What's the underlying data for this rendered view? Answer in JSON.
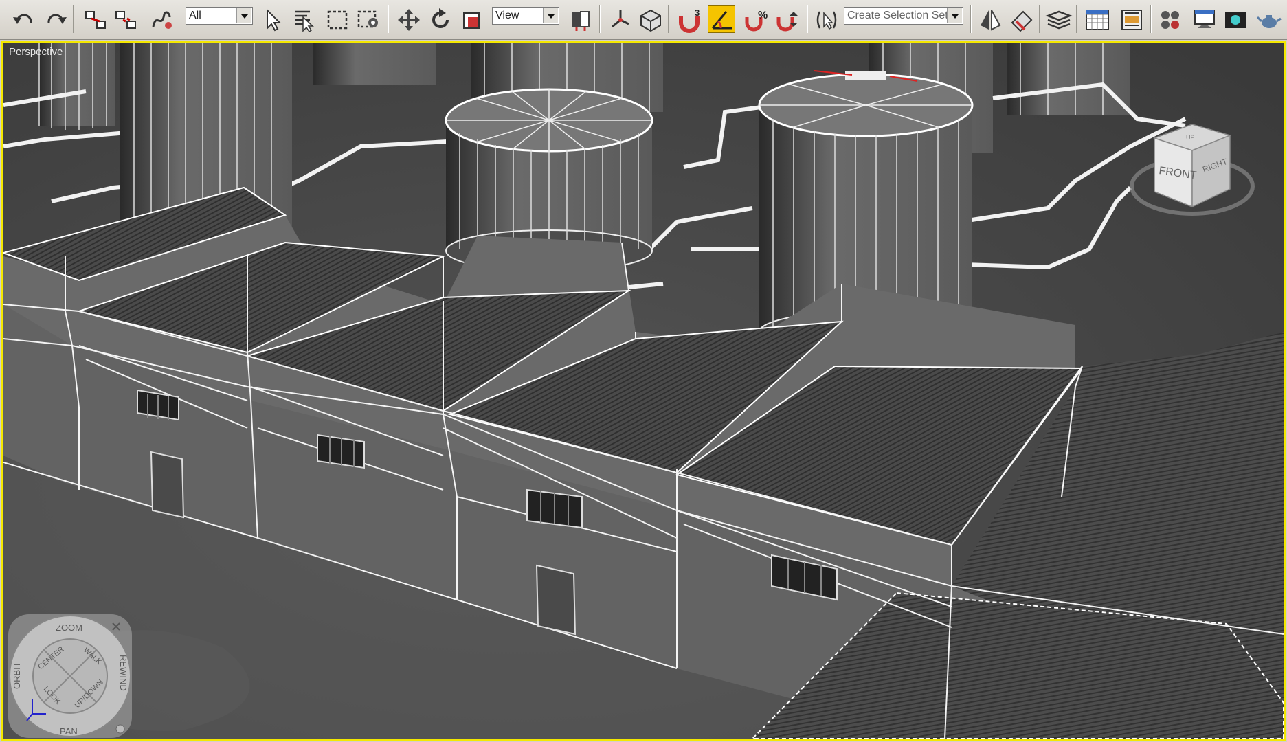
{
  "toolbar": {
    "selection_filter": "All",
    "reference_coord": "View",
    "named_selection_placeholder": "Create Selection Set",
    "snap_count": "3",
    "percent_snap": "%",
    "buttons": [
      {
        "name": "undo",
        "icon": "undo-icon"
      },
      {
        "name": "redo",
        "icon": "redo-icon"
      },
      {
        "name": "select-and-link",
        "icon": "link-icon"
      },
      {
        "name": "unlink-selection",
        "icon": "unlink-icon"
      },
      {
        "name": "bind-to-space-warp",
        "icon": "bind-icon"
      },
      {
        "name": "select-object",
        "icon": "cursor-icon"
      },
      {
        "name": "select-by-name",
        "icon": "list-select-icon"
      },
      {
        "name": "rectangular-selection",
        "icon": "rect-select-icon"
      },
      {
        "name": "window-crossing",
        "icon": "window-crossing-icon"
      },
      {
        "name": "select-and-move",
        "icon": "move-icon"
      },
      {
        "name": "select-and-rotate",
        "icon": "rotate-icon"
      },
      {
        "name": "select-and-scale",
        "icon": "scale-icon"
      },
      {
        "name": "use-pivot-center",
        "icon": "pivot-icon"
      },
      {
        "name": "select-and-manipulate",
        "icon": "manipulate-icon"
      },
      {
        "name": "keyboard-shortcut-override",
        "icon": "keyboard-icon"
      },
      {
        "name": "snaps-toggle",
        "icon": "magnet-icon"
      },
      {
        "name": "angle-snap-toggle",
        "icon": "angle-snap-icon",
        "active": true
      },
      {
        "name": "percent-snap-toggle",
        "icon": "percent-snap-icon"
      },
      {
        "name": "spinner-snap-toggle",
        "icon": "spinner-snap-icon"
      },
      {
        "name": "edit-named-selection",
        "icon": "named-selection-icon"
      },
      {
        "name": "mirror",
        "icon": "mirror-icon"
      },
      {
        "name": "align",
        "icon": "align-icon"
      },
      {
        "name": "layer-manager",
        "icon": "layers-icon"
      },
      {
        "name": "graphite-modeling-tools",
        "icon": "ribbon-icon"
      },
      {
        "name": "curve-editor",
        "icon": "curve-editor-icon"
      },
      {
        "name": "schematic-view",
        "icon": "schematic-icon"
      },
      {
        "name": "material-editor",
        "icon": "material-editor-icon"
      },
      {
        "name": "render-setup",
        "icon": "render-setup-icon"
      },
      {
        "name": "rendered-frame-window",
        "icon": "render-frame-icon"
      },
      {
        "name": "render-production",
        "icon": "teapot-icon"
      }
    ]
  },
  "viewport": {
    "label": "Perspective",
    "border_color": "#f4e800"
  },
  "viewcube": {
    "front_label": "FRONT",
    "right_label": "RIGHT",
    "top_label": "UP"
  },
  "steering_wheel": {
    "zoom": "ZOOM",
    "orbit": "ORBIT",
    "rewind": "REWIND",
    "pan": "PAN",
    "center": "CENTER",
    "walk": "WALK",
    "look": "LOOK",
    "updown": "UP/DOWN"
  }
}
